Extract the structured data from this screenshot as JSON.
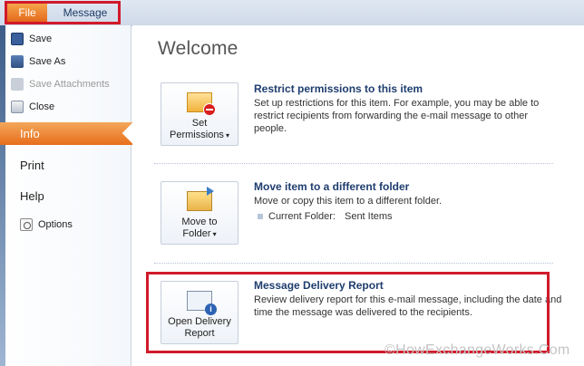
{
  "tabs": {
    "file": "File",
    "message": "Message"
  },
  "sidebar": {
    "commands": [
      {
        "label": "Save",
        "icon": "save-icon",
        "enabled": true
      },
      {
        "label": "Save As",
        "icon": "save-as-icon",
        "enabled": true
      },
      {
        "label": "Save Attachments",
        "icon": "save-attachments-icon",
        "enabled": false
      },
      {
        "label": "Close",
        "icon": "close-icon",
        "enabled": true
      }
    ],
    "nav": {
      "info": "Info",
      "print": "Print",
      "help": "Help",
      "options": "Options"
    }
  },
  "main": {
    "title": "Welcome",
    "sections": [
      {
        "button_line1": "Set",
        "button_line2": "Permissions",
        "icon": "envelope-restrict-icon",
        "title": "Restrict permissions to this item",
        "body": "Set up restrictions for this item. For example, you may be able to restrict recipients from forwarding the e-mail message to other people."
      },
      {
        "button_line1": "Move to",
        "button_line2": "Folder",
        "icon": "move-folder-icon",
        "title": "Move item to a different folder",
        "body": "Move or copy this item to a different folder.",
        "folder_label": "Current Folder:",
        "folder_value": "Sent Items"
      },
      {
        "button_line1": "Open Delivery",
        "button_line2": "Report",
        "icon": "delivery-report-icon",
        "title": "Message Delivery Report",
        "body": "Review delivery report for this e-mail message, including the date and time the message was delivered to the recipients."
      }
    ]
  },
  "watermark": "©HowExchangeWorks.Com",
  "colors": {
    "file_tab": "#e4681c",
    "info_highlight": "#e76e1c",
    "title_blue": "#1e3d6e",
    "annotation_red": "#d11a2a"
  }
}
